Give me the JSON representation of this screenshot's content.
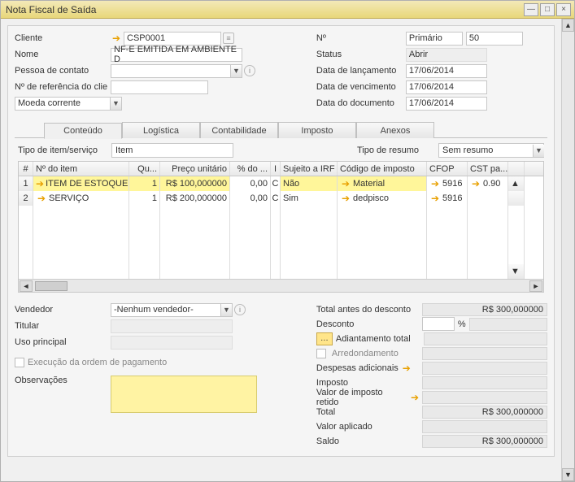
{
  "window_title": "Nota Fiscal de Saída",
  "header": {
    "left": {
      "cliente_label": "Cliente",
      "cliente_value": "CSP0001",
      "nome_label": "Nome",
      "nome_value": "NF-E EMITIDA EM AMBIENTE D",
      "contato_label": "Pessoa de contato",
      "contato_value": "",
      "ref_label": "Nº de referência do clie",
      "ref_value": "",
      "moeda_label": "Moeda corrente",
      "moeda_value": ""
    },
    "right": {
      "no_label": "Nº",
      "no_series": "Primário",
      "no_value": "50",
      "status_label": "Status",
      "status_value": "Abrir",
      "lanc_label": "Data de lançamento",
      "lanc_value": "17/06/2014",
      "venc_label": "Data de vencimento",
      "venc_value": "17/06/2014",
      "doc_label": "Data do documento",
      "doc_value": "17/06/2014"
    }
  },
  "tabs": {
    "t1": "Conteúdo",
    "t2": "Logística",
    "t3": "Contabilidade",
    "t4": "Imposto",
    "t5": "Anexos"
  },
  "grid": {
    "tipo_item_label": "Tipo de item/serviço",
    "tipo_item_value": "Item",
    "tipo_resumo_label": "Tipo de resumo",
    "tipo_resumo_value": "Sem resumo",
    "cols": {
      "num": "#",
      "item": "Nº do item",
      "qty": "Qu...",
      "price": "Preço unitário",
      "pct": "% do ...",
      "i": "I",
      "irf": "Sujeito a IRF",
      "tax": "Código de imposto",
      "cfop": "CFOP",
      "cst": "CST pa..."
    },
    "rows": [
      {
        "n": "1",
        "item": "ITEM DE ESTOQUE",
        "qty": "1",
        "price": "R$ 100,000000",
        "pct": "0,00",
        "i": "C",
        "irf": "Não",
        "tax": "Material",
        "cfop": "5916",
        "cst": "0.90"
      },
      {
        "n": "2",
        "item": "SERVIÇO",
        "qty": "1",
        "price": "R$ 200,000000",
        "pct": "0,00",
        "i": "C",
        "irf": "Sim",
        "tax": "dedpisco",
        "cfop": "5916",
        "cst": ""
      }
    ]
  },
  "footer": {
    "vendedor_label": "Vendedor",
    "vendedor_value": "-Nenhum vendedor-",
    "titular_label": "Titular",
    "uso_label": "Uso principal",
    "exec_label": "Execução da ordem de pagamento",
    "obs_label": "Observações",
    "totals": {
      "tad_label": "Total antes do desconto",
      "tad_value": "R$ 300,000000",
      "desc_label": "Desconto",
      "pct_sym": "%",
      "adiant_label": "Adiantamento total",
      "arred_label": "Arredondamento",
      "desp_label": "Despesas adicionais",
      "imposto_label": "Imposto",
      "irf_label": "Valor de imposto retido",
      "total_label": "Total",
      "total_value": "R$ 300,000000",
      "valapl_label": "Valor aplicado",
      "saldo_label": "Saldo",
      "saldo_value": "R$ 300,000000"
    }
  }
}
